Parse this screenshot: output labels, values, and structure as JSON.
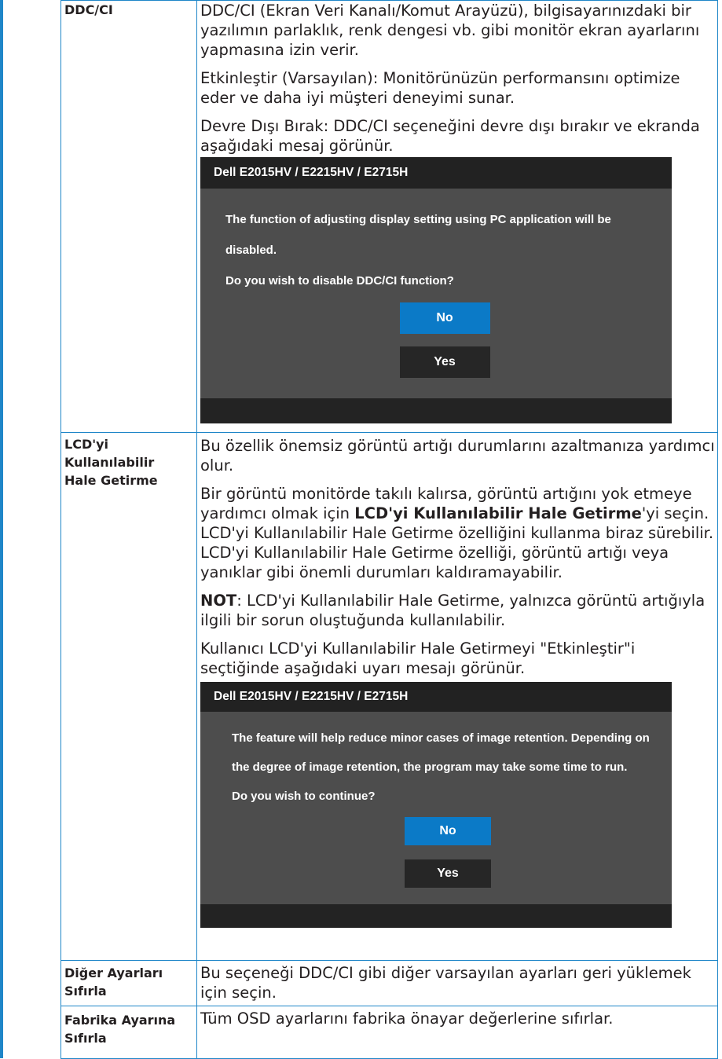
{
  "rows": [
    {
      "label_lines": [
        "DDC/CI"
      ],
      "paras": [
        "DDC/CI (Ekran Veri Kanalı/Komut Arayüzü), bilgisayarınızdaki bir yazılımın parlaklık, renk dengesi vb. gibi monitör ekran ayarlarını yapmasına izin verir.",
        "Etkinleştir (Varsayılan): Monitörünüzün performansını optimize eder ve daha iyi müşteri deneyimi sunar.",
        "Devre Dışı Bırak: DDC/CI seçeneğini devre dışı bırakır ve ekranda aşağıdaki mesaj görünür."
      ],
      "dialog": {
        "title": "Dell E2015HV / E2215HV / E2715H",
        "lines": [
          "The function of adjusting display setting using PC application will be",
          "disabled.",
          "Do you wish to disable DDC/CI function?"
        ],
        "no_label": "No",
        "yes_label": "Yes"
      }
    },
    {
      "label_lines": [
        "LCD'yi",
        "Kullanılabilir",
        "Hale Getirme"
      ],
      "paras": [
        "Bu özellik önemsiz görüntü artığı durumlarını azaltmanıza yardımcı olur."
      ],
      "para2": {
        "before": "Bir görüntü monitörde takılı kalırsa, görüntü artığını yok etmeye yardımcı olmak için ",
        "bold": "LCD'yi Kullanılabilir Hale Getirme",
        "after": "'yi seçin. LCD'yi Kullanılabilir Hale Getirme özelliğini kullanma biraz sürebilir. LCD'yi Kullanılabilir Hale Getirme özelliği, görüntü artığı veya yanıklar gibi önemli durumları kaldıramayabilir."
      },
      "note": {
        "bold": "NOT",
        "text": ": LCD'yi Kullanılabilir Hale Getirme, yalnızca görüntü artığıyla ilgili bir sorun oluştuğunda kullanılabilir."
      },
      "para4": "Kullanıcı LCD'yi Kullanılabilir Hale Getirmeyi \"Etkinleştir\"i seçtiğinde aşağıdaki uyarı mesajı görünür.",
      "dialog": {
        "title": "Dell E2015HV / E2215HV / E2715H",
        "lines": [
          "The feature will help reduce minor cases of image retention. Depending on",
          "the degree of image retention, the program may take some time to run.",
          "Do you wish to continue?"
        ],
        "no_label": "No",
        "yes_label": "Yes"
      }
    },
    {
      "label_lines": [
        "Diğer Ayarları",
        "Sıfırla"
      ],
      "paras": [
        "Bu seçeneği DDC/CI gibi diğer varsayılan ayarları geri yüklemek için seçin."
      ]
    },
    {
      "label_lines": [
        "Fabrika Ayarına",
        "Sıfırla"
      ],
      "paras": [
        "Tüm OSD ayarlarını fabrika önayar değerlerine sıfırlar."
      ]
    }
  ],
  "colors": {
    "border": "#1f86c8",
    "dialog_body": "#4d4d4d",
    "dialog_title": "#222222",
    "button_no": "#0b7ac7",
    "button_yes": "#262626"
  }
}
